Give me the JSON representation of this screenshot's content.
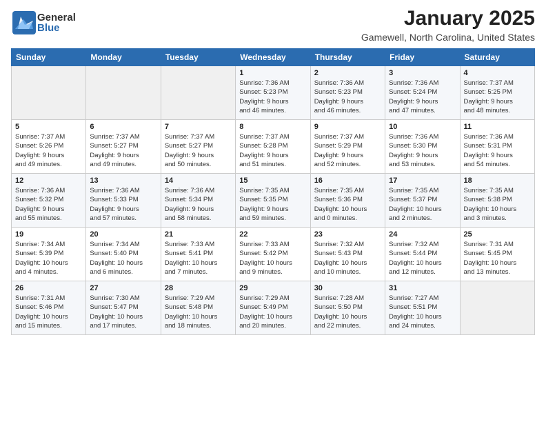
{
  "header": {
    "logo": {
      "general": "General",
      "blue": "Blue"
    },
    "title": "January 2025",
    "subtitle": "Gamewell, North Carolina, United States"
  },
  "weekdays": [
    "Sunday",
    "Monday",
    "Tuesday",
    "Wednesday",
    "Thursday",
    "Friday",
    "Saturday"
  ],
  "weeks": [
    [
      {
        "day": "",
        "info": ""
      },
      {
        "day": "",
        "info": ""
      },
      {
        "day": "",
        "info": ""
      },
      {
        "day": "1",
        "info": "Sunrise: 7:36 AM\nSunset: 5:23 PM\nDaylight: 9 hours\nand 46 minutes."
      },
      {
        "day": "2",
        "info": "Sunrise: 7:36 AM\nSunset: 5:23 PM\nDaylight: 9 hours\nand 46 minutes."
      },
      {
        "day": "3",
        "info": "Sunrise: 7:36 AM\nSunset: 5:24 PM\nDaylight: 9 hours\nand 47 minutes."
      },
      {
        "day": "4",
        "info": "Sunrise: 7:37 AM\nSunset: 5:25 PM\nDaylight: 9 hours\nand 48 minutes."
      }
    ],
    [
      {
        "day": "5",
        "info": "Sunrise: 7:37 AM\nSunset: 5:26 PM\nDaylight: 9 hours\nand 49 minutes."
      },
      {
        "day": "6",
        "info": "Sunrise: 7:37 AM\nSunset: 5:27 PM\nDaylight: 9 hours\nand 49 minutes."
      },
      {
        "day": "7",
        "info": "Sunrise: 7:37 AM\nSunset: 5:27 PM\nDaylight: 9 hours\nand 50 minutes."
      },
      {
        "day": "8",
        "info": "Sunrise: 7:37 AM\nSunset: 5:28 PM\nDaylight: 9 hours\nand 51 minutes."
      },
      {
        "day": "9",
        "info": "Sunrise: 7:37 AM\nSunset: 5:29 PM\nDaylight: 9 hours\nand 52 minutes."
      },
      {
        "day": "10",
        "info": "Sunrise: 7:36 AM\nSunset: 5:30 PM\nDaylight: 9 hours\nand 53 minutes."
      },
      {
        "day": "11",
        "info": "Sunrise: 7:36 AM\nSunset: 5:31 PM\nDaylight: 9 hours\nand 54 minutes."
      }
    ],
    [
      {
        "day": "12",
        "info": "Sunrise: 7:36 AM\nSunset: 5:32 PM\nDaylight: 9 hours\nand 55 minutes."
      },
      {
        "day": "13",
        "info": "Sunrise: 7:36 AM\nSunset: 5:33 PM\nDaylight: 9 hours\nand 57 minutes."
      },
      {
        "day": "14",
        "info": "Sunrise: 7:36 AM\nSunset: 5:34 PM\nDaylight: 9 hours\nand 58 minutes."
      },
      {
        "day": "15",
        "info": "Sunrise: 7:35 AM\nSunset: 5:35 PM\nDaylight: 9 hours\nand 59 minutes."
      },
      {
        "day": "16",
        "info": "Sunrise: 7:35 AM\nSunset: 5:36 PM\nDaylight: 10 hours\nand 0 minutes."
      },
      {
        "day": "17",
        "info": "Sunrise: 7:35 AM\nSunset: 5:37 PM\nDaylight: 10 hours\nand 2 minutes."
      },
      {
        "day": "18",
        "info": "Sunrise: 7:35 AM\nSunset: 5:38 PM\nDaylight: 10 hours\nand 3 minutes."
      }
    ],
    [
      {
        "day": "19",
        "info": "Sunrise: 7:34 AM\nSunset: 5:39 PM\nDaylight: 10 hours\nand 4 minutes."
      },
      {
        "day": "20",
        "info": "Sunrise: 7:34 AM\nSunset: 5:40 PM\nDaylight: 10 hours\nand 6 minutes."
      },
      {
        "day": "21",
        "info": "Sunrise: 7:33 AM\nSunset: 5:41 PM\nDaylight: 10 hours\nand 7 minutes."
      },
      {
        "day": "22",
        "info": "Sunrise: 7:33 AM\nSunset: 5:42 PM\nDaylight: 10 hours\nand 9 minutes."
      },
      {
        "day": "23",
        "info": "Sunrise: 7:32 AM\nSunset: 5:43 PM\nDaylight: 10 hours\nand 10 minutes."
      },
      {
        "day": "24",
        "info": "Sunrise: 7:32 AM\nSunset: 5:44 PM\nDaylight: 10 hours\nand 12 minutes."
      },
      {
        "day": "25",
        "info": "Sunrise: 7:31 AM\nSunset: 5:45 PM\nDaylight: 10 hours\nand 13 minutes."
      }
    ],
    [
      {
        "day": "26",
        "info": "Sunrise: 7:31 AM\nSunset: 5:46 PM\nDaylight: 10 hours\nand 15 minutes."
      },
      {
        "day": "27",
        "info": "Sunrise: 7:30 AM\nSunset: 5:47 PM\nDaylight: 10 hours\nand 17 minutes."
      },
      {
        "day": "28",
        "info": "Sunrise: 7:29 AM\nSunset: 5:48 PM\nDaylight: 10 hours\nand 18 minutes."
      },
      {
        "day": "29",
        "info": "Sunrise: 7:29 AM\nSunset: 5:49 PM\nDaylight: 10 hours\nand 20 minutes."
      },
      {
        "day": "30",
        "info": "Sunrise: 7:28 AM\nSunset: 5:50 PM\nDaylight: 10 hours\nand 22 minutes."
      },
      {
        "day": "31",
        "info": "Sunrise: 7:27 AM\nSunset: 5:51 PM\nDaylight: 10 hours\nand 24 minutes."
      },
      {
        "day": "",
        "info": ""
      }
    ]
  ]
}
